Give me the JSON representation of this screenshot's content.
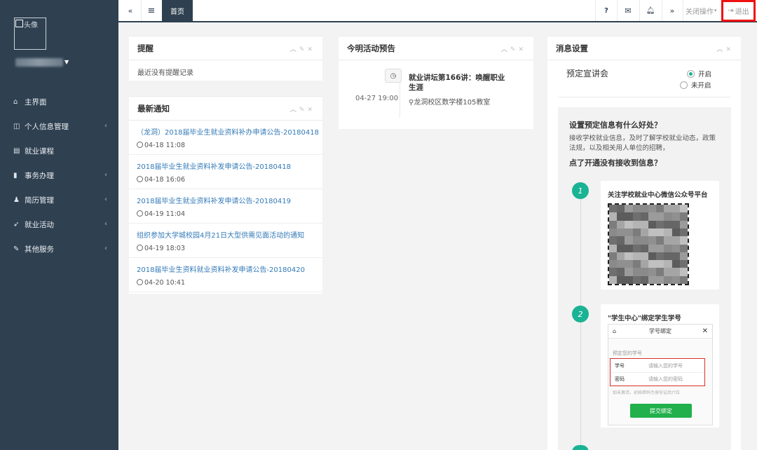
{
  "sidebar": {
    "avatar_alt": "头像",
    "menu": [
      {
        "label": "主界面",
        "icon": "home-icon",
        "glyph": "⌂",
        "has_arrow": false
      },
      {
        "label": "个人信息管理",
        "icon": "id-card-icon",
        "glyph": "◫",
        "has_arrow": true
      },
      {
        "label": "就业课程",
        "icon": "book-icon",
        "glyph": "▤",
        "has_arrow": false
      },
      {
        "label": "事务办理",
        "icon": "file-icon",
        "glyph": "▮",
        "has_arrow": true
      },
      {
        "label": "简历管理",
        "icon": "sitemap-icon",
        "glyph": "♟",
        "has_arrow": true
      },
      {
        "label": "就业活动",
        "icon": "rocket-icon",
        "glyph": "➶",
        "has_arrow": true
      },
      {
        "label": "其他服务",
        "icon": "edit-icon",
        "glyph": "✎",
        "has_arrow": true
      }
    ]
  },
  "topbar": {
    "home_tab": "首页",
    "help": "?",
    "close_ops": "关闭操作",
    "logout": "退出"
  },
  "reminder": {
    "title": "提醒",
    "empty_text": "最近没有提醒记录"
  },
  "notices": {
    "title": "最新通知",
    "items": [
      {
        "text": "（龙洞）2018届毕业生就业资料补办申请公告-20180418",
        "time": "04-18 11:08"
      },
      {
        "text": "2018届毕业生就业资料补发申请公告-20180418",
        "time": "04-18 16:06"
      },
      {
        "text": "2018届毕业生就业资料补发申请公告-20180419",
        "time": "04-19 11:04"
      },
      {
        "text": "组织参加大学城校园4月21日大型供需见面活动的通知",
        "time": "04-19 18:03"
      },
      {
        "text": "2018届毕业生资料就业资料补发申请公告-20180420",
        "time": "04-20 10:41"
      }
    ]
  },
  "activity": {
    "title": "今明活动预告",
    "date": "04-27 19:00",
    "event_title": "就业讲坛第166讲：唤醒职业生涯",
    "location": "龙洞校区数学楼105教室"
  },
  "settings": {
    "title": "消息设置",
    "option_label": "预定宣讲会",
    "radio_on": "开启",
    "radio_off": "未开启",
    "benefit_heading": "设置预定信息有什么好处？",
    "benefit_text": "接收学校就业信息，及时了解学校就业动态，政策法规，以及相关用人单位的招聘，",
    "question": "点了开通没有接收到信息？",
    "step1_num": "1",
    "step1_title": "关注学校就业中心微信公众号平台",
    "step2_num": "2",
    "step2_title": "\"学生中心\"绑定学生学号",
    "mini": {
      "header": "学号绑定",
      "hint": "预定您的学号",
      "student_label": "学号",
      "student_placeholder": "请输入您的学号",
      "password_label": "密码",
      "password_placeholder": "请输入您的密码",
      "note": "如未激活，初始密码为身份证后六位",
      "submit": "提交绑定"
    }
  },
  "colors": {
    "sidebar_bg": "#2f4050",
    "accent_green": "#1ab394",
    "link_blue": "#337ab7",
    "highlight_red": "#ee1111"
  }
}
